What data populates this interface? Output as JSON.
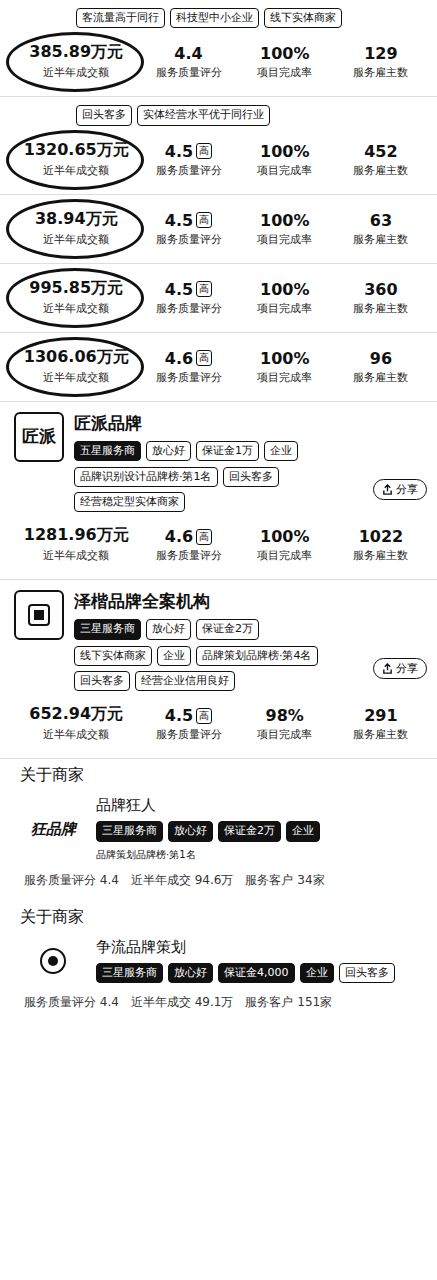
{
  "top_listings": [
    {
      "tags": [
        "客流量高于同行",
        "科技型中小企业",
        "线下实体商家"
      ],
      "circled": true,
      "stats": {
        "amount": "385.89万元",
        "amount_label": "近半年成交额",
        "rating": "4.4",
        "rating_badge": "",
        "rating_label": "服务质量评分",
        "completion": "100%",
        "completion_label": "项目完成率",
        "clients": "129",
        "clients_label": "服务雇主数"
      }
    },
    {
      "tags": [
        "回头客多",
        "实体经营水平优于同行业"
      ],
      "circled": true,
      "stats": {
        "amount": "1320.65万元",
        "amount_label": "近半年成交额",
        "rating": "4.5",
        "rating_badge": "高",
        "rating_label": "服务质量评分",
        "completion": "100%",
        "completion_label": "项目完成率",
        "clients": "452",
        "clients_label": "服务雇主数"
      }
    },
    {
      "tags": [],
      "circled": true,
      "stats": {
        "amount": "38.94万元",
        "amount_label": "近半年成交额",
        "rating": "4.5",
        "rating_badge": "高",
        "rating_label": "服务质量评分",
        "completion": "100%",
        "completion_label": "项目完成率",
        "clients": "63",
        "clients_label": "服务雇主数"
      }
    },
    {
      "tags": [],
      "circled": true,
      "stats": {
        "amount": "995.85万元",
        "amount_label": "近半年成交额",
        "rating": "4.5",
        "rating_badge": "高",
        "rating_label": "服务质量评分",
        "completion": "100%",
        "completion_label": "项目完成率",
        "clients": "360",
        "clients_label": "服务雇主数"
      }
    },
    {
      "tags": [],
      "circled": true,
      "stats": {
        "amount": "1306.06万元",
        "amount_label": "近半年成交额",
        "rating": "4.6",
        "rating_badge": "高",
        "rating_label": "服务质量评分",
        "completion": "100%",
        "completion_label": "项目完成率",
        "clients": "96",
        "clients_label": "服务雇主数"
      }
    }
  ],
  "merchants": [
    {
      "logo_text": "匠派",
      "name": "匠派品牌",
      "badges": [
        "五星服务商",
        "放心好",
        "保证金1万",
        "企业"
      ],
      "tags": [
        "品牌识别设计品牌榜·第1名",
        "回头客多",
        "经营稳定型实体商家"
      ],
      "share": "分享",
      "stats": {
        "amount": "1281.96万元",
        "amount_label": "近半年成交额",
        "rating": "4.6",
        "rating_badge": "高",
        "rating_label": "服务质量评分",
        "completion": "100%",
        "completion_label": "项目完成率",
        "clients": "1022",
        "clients_label": "服务雇主数"
      }
    },
    {
      "logo_text": "",
      "name": "泽楷品牌全案机构",
      "badges": [
        "三星服务商",
        "放心好",
        "保证金2万"
      ],
      "tags": [
        "线下实体商家",
        "企业",
        "品牌策划品牌榜·第4名",
        "回头客多",
        "经营企业信用良好"
      ],
      "share": "分享",
      "stats": {
        "amount": "652.94万元",
        "amount_label": "近半年成交额",
        "rating": "4.5",
        "rating_badge": "高",
        "rating_label": "服务质量评分",
        "completion": "98%",
        "completion_label": "项目完成率",
        "clients": "291",
        "clients_label": "服务雇主数"
      }
    }
  ],
  "about": [
    {
      "heading": "关于商家",
      "logo_text": "狂品牌",
      "name": "品牌狂人",
      "badges": [
        "三星服务商",
        "放心好",
        "保证金2万",
        "企业"
      ],
      "ranking": "品牌策划品牌榜·第1名",
      "summary": [
        "服务质量评分 4.4",
        "近半年成交 94.6万",
        "服务客户 34家"
      ]
    },
    {
      "heading": "关于商家",
      "logo_text": "",
      "name": "争流品牌策划",
      "badges": [
        "三星服务商",
        "放心好",
        "保证金4,000",
        "企业",
        "回头客多"
      ],
      "ranking": "",
      "summary": [
        "服务质量评分 4.4",
        "近半年成交 49.1万",
        "服务客户 151家"
      ]
    }
  ]
}
